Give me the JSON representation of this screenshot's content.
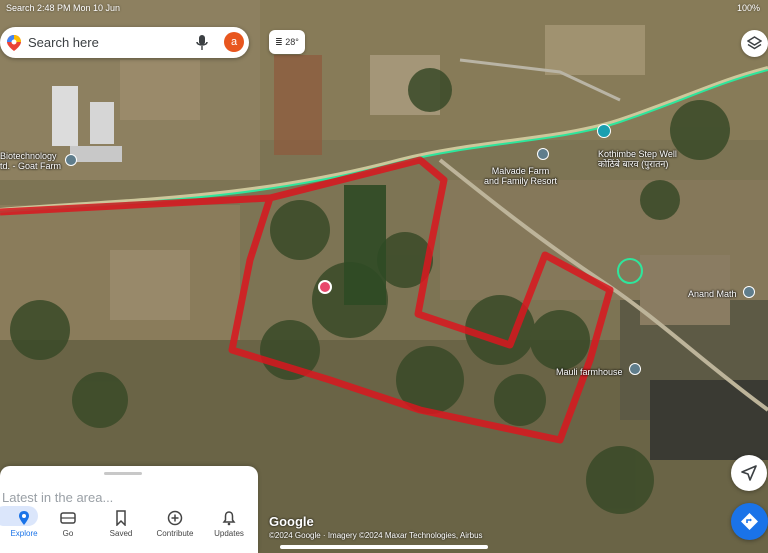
{
  "status_bar": {
    "left": "Search  2:48 PM  Mon 10 Jun",
    "right": "100%"
  },
  "search": {
    "placeholder": "Search here",
    "avatar_letter": "a",
    "icons": [
      "google-maps-pin-icon",
      "mic-icon"
    ]
  },
  "weather": {
    "temp": "28°"
  },
  "map_labels": {
    "biotech": "Biotechnology",
    "biotech2": "td. - Goat Farm",
    "malvade": "Malvade Farm",
    "malvade2": "and Family Resort",
    "kothimbe": "Kothimbe Step Well",
    "kothimbe2": "कोठिंबे बारव (पुरातन)",
    "anand": "Anand Math",
    "mauli": "Mauli farmhouse"
  },
  "colors": {
    "boundary": "#d9161f",
    "route": "#2ee69c",
    "accent": "#1a73e8"
  },
  "bottom_sheet": {
    "latest": "Latest in the area..."
  },
  "nav": [
    {
      "label": "Explore",
      "icon": "explore-pin-icon"
    },
    {
      "label": "Go",
      "icon": "car-icon"
    },
    {
      "label": "Saved",
      "icon": "bookmark-icon"
    },
    {
      "label": "Contribute",
      "icon": "add-circle-icon"
    },
    {
      "label": "Updates",
      "icon": "bell-icon"
    }
  ],
  "attribution": {
    "logo": "Google",
    "text": "©2024 Google · Imagery ©2024 Maxar Technologies, Airbus"
  }
}
